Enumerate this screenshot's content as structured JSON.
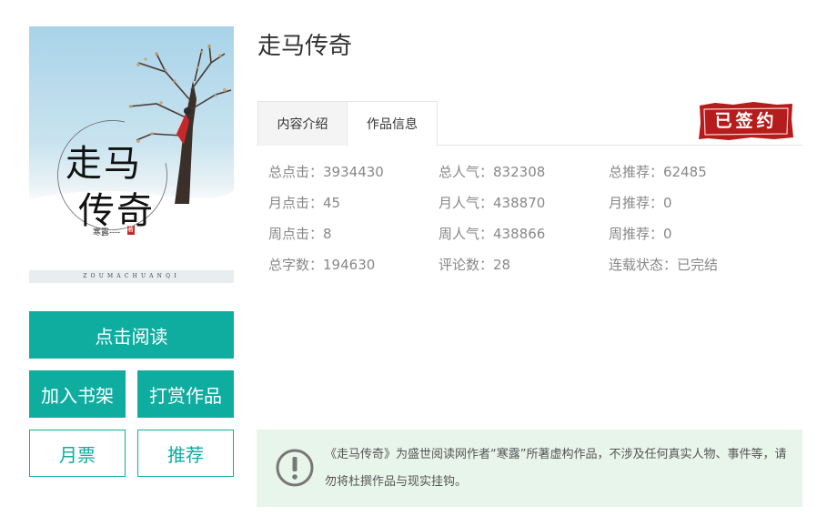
{
  "book": {
    "title": "走马传奇",
    "cover": {
      "title_line1": "走马",
      "title_line2": "传奇",
      "author_mark": "寒露----",
      "author_seal": "著",
      "pinyin": "ZOUMACHUANQI"
    }
  },
  "actions": {
    "read_label": "点击阅读",
    "shelf_label": "加入书架",
    "reward_label": "打赏作品",
    "ticket_label": "月票",
    "recommend_label": "推荐"
  },
  "tabs": [
    {
      "label": "内容介绍",
      "active": false
    },
    {
      "label": "作品信息",
      "active": true
    }
  ],
  "stamp_text": "已签约",
  "stats": [
    {
      "label": "总点击：",
      "value": "3934430"
    },
    {
      "label": "总人气：",
      "value": "832308"
    },
    {
      "label": "总推荐：",
      "value": "62485"
    },
    {
      "label": "月点击：",
      "value": "45"
    },
    {
      "label": "月人气：",
      "value": "438870"
    },
    {
      "label": "月推荐：",
      "value": "0"
    },
    {
      "label": "周点击：",
      "value": "8"
    },
    {
      "label": "周人气：",
      "value": "438866"
    },
    {
      "label": "周推荐：",
      "value": "0"
    },
    {
      "label": "总字数：",
      "value": "194630"
    },
    {
      "label": "评论数：",
      "value": "28"
    },
    {
      "label": "连载状态：",
      "value": "已完结"
    }
  ],
  "notice": {
    "text": "《走马传奇》为盛世阅读网作者“寒露”所著虚构作品，不涉及任何真实人物、事件等，请勿将杜撰作品与现实挂钩。"
  },
  "colors": {
    "accent": "#0eada0",
    "notice_bg": "#e8f5ea",
    "stamp_red": "#b71c1c"
  }
}
